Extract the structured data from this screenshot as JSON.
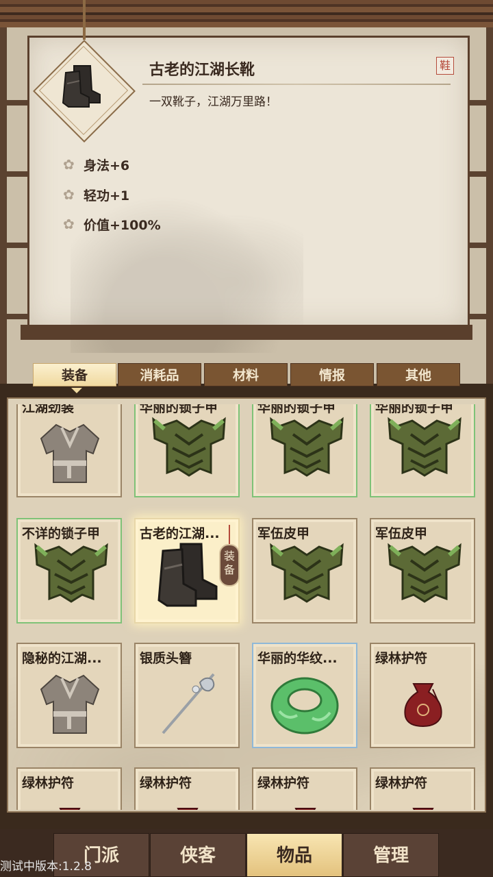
{
  "detail": {
    "item_name": "古老的江湖长靴",
    "slot_tag": "鞋",
    "description": "一双靴子，江湖万里路！",
    "stats": [
      "身法+6",
      "轻功+1",
      "价值+100%"
    ]
  },
  "tabs": [
    "装备",
    "消耗品",
    "材料",
    "情报",
    "其他"
  ],
  "active_tab": "装备",
  "inventory": {
    "items": [
      {
        "name": "江湖劲装",
        "icon": "robe-icon",
        "border": "plain"
      },
      {
        "name": "华丽的锁子甲",
        "icon": "armor-icon",
        "border": "green"
      },
      {
        "name": "华丽的锁子甲",
        "icon": "armor-icon",
        "border": "green"
      },
      {
        "name": "华丽的锁子甲",
        "icon": "armor-icon",
        "border": "green"
      },
      {
        "name": "不详的锁子甲",
        "icon": "armor-icon",
        "border": "green"
      },
      {
        "name": "古老的江湖...",
        "icon": "boots-icon",
        "border": "selected"
      },
      {
        "name": "军伍皮甲",
        "icon": "armor-icon",
        "border": "plain"
      },
      {
        "name": "军伍皮甲",
        "icon": "armor-icon",
        "border": "plain"
      },
      {
        "name": "隐秘的江湖...",
        "icon": "robe-icon",
        "border": "plain"
      },
      {
        "name": "银质头簪",
        "icon": "hairpin-icon",
        "border": "plain"
      },
      {
        "name": "华丽的华纹...",
        "icon": "jade-ring-icon",
        "border": "blue"
      },
      {
        "name": "绿林护符",
        "icon": "pouch-icon",
        "border": "plain"
      },
      {
        "name": "绿林护符",
        "icon": "pouch-icon",
        "border": "plain"
      },
      {
        "name": "绿林护符",
        "icon": "pouch-icon",
        "border": "plain"
      },
      {
        "name": "绿林护符",
        "icon": "pouch-icon",
        "border": "plain"
      },
      {
        "name": "绿林护符",
        "icon": "pouch-icon",
        "border": "plain"
      }
    ],
    "equipped_badge": "装备"
  },
  "nav": [
    "门派",
    "侠客",
    "物品",
    "管理"
  ],
  "active_nav": "物品",
  "version_text": "测试中版本:1.2.8"
}
